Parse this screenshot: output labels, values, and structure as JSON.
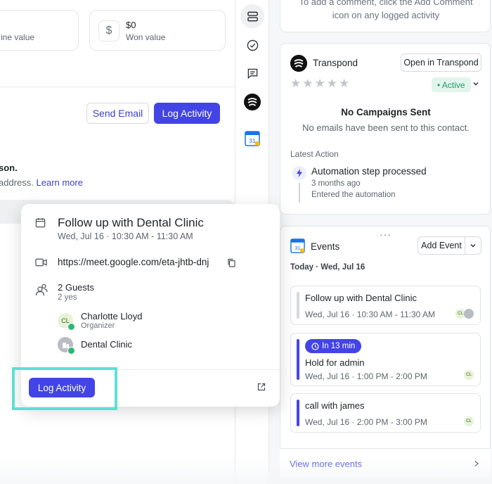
{
  "stats": {
    "pipeline_label": "ine value",
    "won_icon": "$",
    "won_value": "$0",
    "won_label": "Won value"
  },
  "actions": {
    "send_email": "Send Email",
    "log_activity": "Log Activity"
  },
  "notice": {
    "bold": "son.",
    "text": "address.",
    "link": "Learn more"
  },
  "popover": {
    "title": "Follow up with Dental Clinic",
    "time": "Wed, Jul 16 · 10:30 AM - 11:30 AM",
    "meet_link": "https://meet.google.com/eta-jhtb-dnj",
    "guests_count": "2 Guests",
    "guests_sub": "2 yes",
    "guests": [
      {
        "initials": "CL",
        "name": "Charlotte Lloyd",
        "role": "Organizer"
      },
      {
        "initials": "",
        "name": "Dental Clinic",
        "role": ""
      }
    ],
    "log_activity": "Log Activity"
  },
  "rail": {
    "icons": [
      "stack-icon",
      "check-circle-icon",
      "comment-icon",
      "transpond-icon",
      "google-calendar-icon"
    ]
  },
  "comment_hint": {
    "line1": "To add a comment, click the Add Comment",
    "line2": "icon on any logged activity"
  },
  "transpond": {
    "title": "Transpond",
    "open_button": "Open in Transpond",
    "stars": "★★★★★",
    "status": "• Active",
    "no_campaigns_title": "No Campaigns Sent",
    "no_campaigns_sub": "No emails have been sent to this contact.",
    "latest_action_label": "Latest Action",
    "latest_action": {
      "title": "Automation step processed",
      "time": "3 months ago",
      "detail": "Entered the automation"
    }
  },
  "events": {
    "title": "Events",
    "dots": "···",
    "add_event": "Add Event",
    "date_header": "Today · Wed, Jul 16",
    "calendar_day": "31",
    "items": [
      {
        "name": "Follow up with Dental Clinic",
        "time": "Wed, Jul 16 · 10:30 AM - 11:30 AM",
        "chip": "",
        "bar_color": "#d5d8dd",
        "avatars": [
          "CL",
          ""
        ]
      },
      {
        "name": "Hold for admin",
        "time": "Wed, Jul 16 · 1:00 PM - 2:00 PM",
        "chip": "In 13 min",
        "bar_color": "#4344e6",
        "avatars": [
          "CL"
        ]
      },
      {
        "name": "call with james",
        "time": "Wed, Jul 16 · 2:00 PM - 3:00 PM",
        "chip": "",
        "bar_color": "#4344e6",
        "avatars": [
          "CL"
        ]
      }
    ],
    "view_more": "View more events"
  },
  "colors": {
    "primary": "#4344e6",
    "link": "#3b3fd8",
    "active_green": "#1f9d6a",
    "highlight": "#5de0d3"
  }
}
